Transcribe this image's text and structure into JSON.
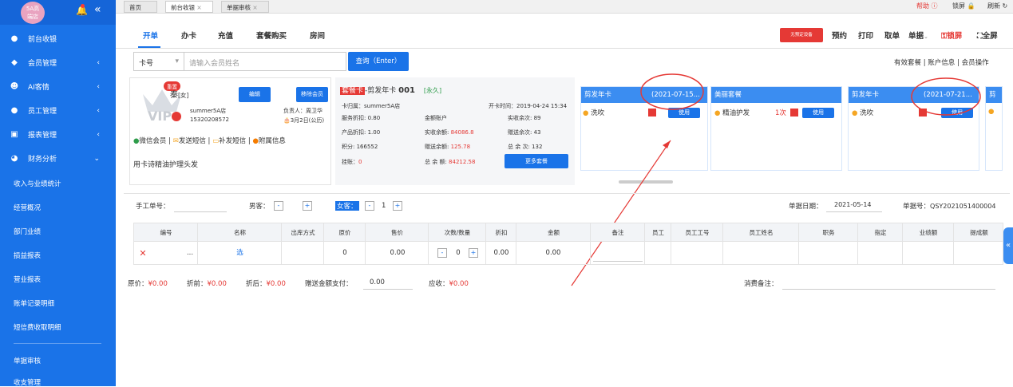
{
  "sidebar": {
    "logo_text_1": "5A高",
    "logo_text_2": "端店",
    "collapse_icon": "double-chevron-left-icon",
    "items": [
      {
        "label": "前台收银",
        "icon": "money-bag-icon",
        "arrow": ""
      },
      {
        "label": "会员管理",
        "icon": "diamond-icon",
        "arrow": "‹"
      },
      {
        "label": "AI客情",
        "icon": "users-icon",
        "arrow": "‹"
      },
      {
        "label": "员工管理",
        "icon": "user-icon",
        "arrow": "‹"
      },
      {
        "label": "报表管理",
        "icon": "monitor-icon",
        "arrow": "‹"
      },
      {
        "label": "财务分析",
        "icon": "pie-chart-icon",
        "arrow": "⌄"
      }
    ],
    "subitems": [
      "收入与业绩统计",
      "经营概况",
      "部门业绩",
      "损益报表",
      "营业报表",
      "账单记录明细",
      "短信费收取明细"
    ],
    "bottom_items": [
      "单据审核",
      "收支管理"
    ]
  },
  "topbar": {
    "tabs": [
      "首页",
      "前台收银",
      "单据审核"
    ],
    "help": "帮助",
    "lock": "锁屏",
    "refresh": "刷新"
  },
  "main_tabs": [
    "开单",
    "办卡",
    "充值",
    "套餐购买",
    "房间"
  ],
  "toolbar_right": {
    "device_label": "无预定设备",
    "items": [
      "预约",
      "打印",
      "取单",
      "单据"
    ],
    "lock": "锁屏",
    "fullscreen": "全屏"
  },
  "search": {
    "select": "卡号",
    "placeholder": "请输入会员姓名",
    "button": "查询（Enter）"
  },
  "links_right": [
    "有效套餐",
    "账户信息",
    "会员操作"
  ],
  "member": {
    "badge": "重置",
    "name": "秦",
    "gender": "[女]",
    "edit": "编辑",
    "remove": "移除会员",
    "store": "summer5A店",
    "phone": "15320208572",
    "owner": "负责人：周卫华",
    "birthday": "🎂3月2日(公历)",
    "actions": [
      "微信会员",
      "发送短信",
      "补发短信",
      "附属信息"
    ],
    "note": "用卡诗精油护理头发"
  },
  "card": {
    "tag": "套餐卡",
    "name": "-剪发年卡",
    "number": "001",
    "validity": "[永久]",
    "belong": "卡归属：summer5A店",
    "open_time": "开卡时间：2019-04-24 15:34",
    "service_discount": "服务折扣: 0.80",
    "product_discount": "产品折扣: 1.00",
    "points": "积分: 166552",
    "hang": "挂账：",
    "hang_val": "0",
    "amount_account": "金额账户",
    "real_balance_lbl": "实收余额:",
    "real_balance": "84086.8",
    "gift_balance_lbl": "赠送余额:",
    "gift_balance": "125.78",
    "total_balance_lbl": "总 余 额:",
    "total_balance": "84212.58",
    "real_times": "实收余次: 89",
    "gift_times": "赠送余次: 43",
    "total_times": "总 余 次: 132",
    "more": "更多套餐"
  },
  "packages": [
    {
      "title": "剪发年卡",
      "date": "(2021-07-15...",
      "item": "洗吹",
      "use": "使用"
    },
    {
      "title": "美丽套餐",
      "date": "",
      "item": "精油护发",
      "count": "1次",
      "use": "使用"
    },
    {
      "title": "剪发年卡",
      "date": "(2021-07-21...",
      "item": "洗吹",
      "use": "使用"
    },
    {
      "title": "剪发",
      "date": "",
      "item": "",
      "use": ""
    }
  ],
  "order": {
    "manual_no": "手工单号：",
    "male": "男客：",
    "male_count": "",
    "female": "女客：",
    "female_count": "1",
    "date_label": "单据日期：",
    "date": "2021-05-14",
    "no_label": "单据号：",
    "no": "QSY2021051400004"
  },
  "table": {
    "headers": [
      "编号",
      "名称",
      "出库方式",
      "原价",
      "售价",
      "次数/数量",
      "折扣",
      "金额",
      "备注",
      "员工",
      "员工工号",
      "员工姓名",
      "职务",
      "指定",
      "业绩额",
      "提成额"
    ],
    "row": {
      "delete": "✕",
      "dots": "...",
      "name": "选",
      "orig": "0",
      "price": "0.00",
      "qty": "0",
      "discount": "0.00",
      "amount": "0.00"
    }
  },
  "totals": {
    "orig_lbl": "原价：",
    "orig": "¥0.00",
    "before_lbl": "折前：",
    "before": "¥0.00",
    "after_lbl": "折后：",
    "after": "¥0.00",
    "gift_lbl": "赠送金额支付：",
    "gift": "0.00",
    "due_lbl": "应收：",
    "due": "¥0.00",
    "remark_lbl": "消费备注："
  },
  "colors": {
    "primary": "#1a73e8",
    "sidebar": "#1a73e8",
    "annotation": "#e53935"
  }
}
